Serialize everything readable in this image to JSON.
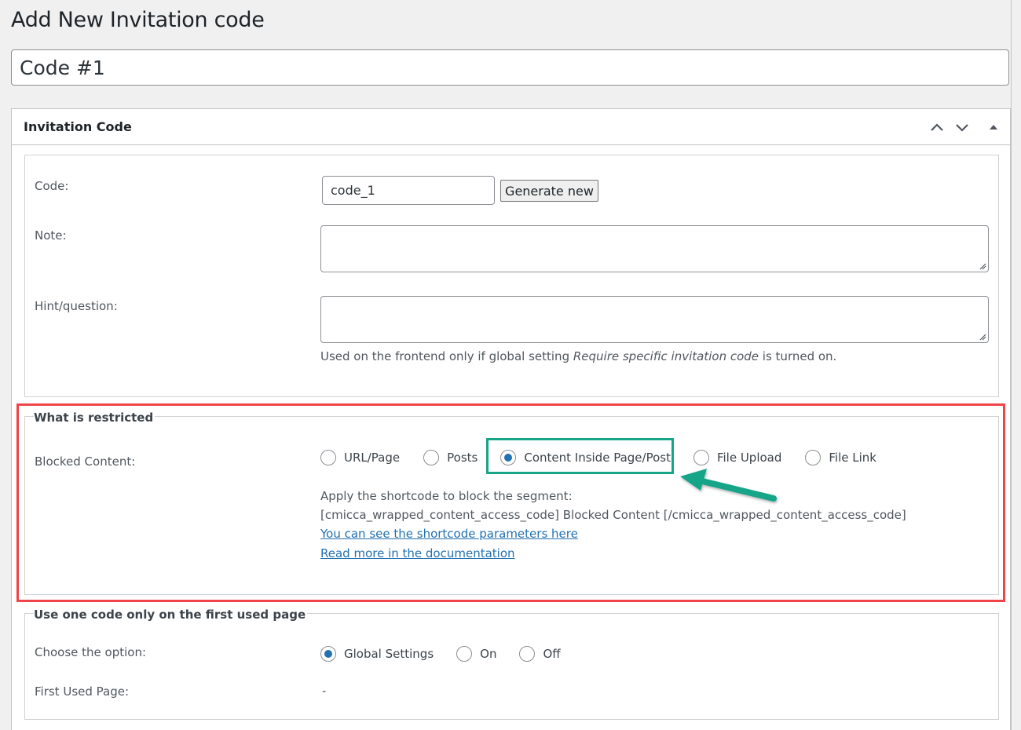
{
  "page": {
    "title": "Add New Invitation code",
    "post_title_value": "Code #1"
  },
  "metabox": {
    "title": "Invitation Code",
    "controls": {
      "move_up": "chevron-up-icon",
      "move_down": "chevron-down-icon",
      "toggle": "triangle-up-icon"
    }
  },
  "general": {
    "code_label": "Code:",
    "code_value": "code_1",
    "generate_button": "Generate new",
    "note_label": "Note:",
    "note_value": "",
    "hint_label": "Hint/question:",
    "hint_value": "",
    "hint_desc_before": "Used on the frontend only if global setting ",
    "hint_desc_em": "Require specific invitation code",
    "hint_desc_after": " is turned on."
  },
  "restricted": {
    "legend": "What is restricted",
    "blocked_label": "Blocked Content:",
    "options": [
      {
        "label": "URL/Page",
        "checked": false
      },
      {
        "label": "Posts",
        "checked": false
      },
      {
        "label": "Content Inside Page/Post",
        "checked": true
      },
      {
        "label": "File Upload",
        "checked": false
      },
      {
        "label": "File Link",
        "checked": false
      }
    ],
    "instruction": "Apply the shortcode to block the segment:",
    "shortcode": "[cmicca_wrapped_content_access_code] Blocked Content [/cmicca_wrapped_content_access_code]",
    "link_params": "You can see the shortcode parameters here",
    "link_docs": "Read more in the documentation"
  },
  "first_page": {
    "legend": "Use one code only on the first used page",
    "choose_label": "Choose the option:",
    "options": [
      {
        "label": "Global Settings",
        "checked": true
      },
      {
        "label": "On",
        "checked": false
      },
      {
        "label": "Off",
        "checked": false
      }
    ],
    "first_used_label": "First Used Page:",
    "first_used_value": "-"
  },
  "annotations": {
    "highlight_color": "#f04448",
    "selection_color": "#17a589",
    "accent_color": "#2271b1"
  }
}
